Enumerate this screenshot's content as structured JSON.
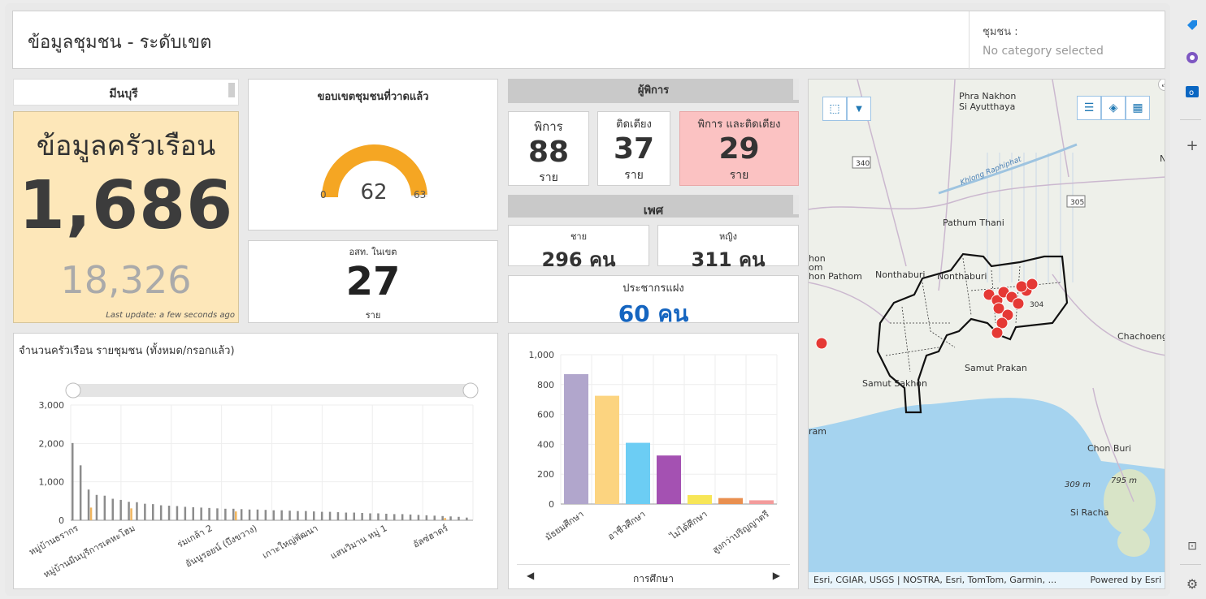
{
  "header": {
    "title": "ข้อมูลชุมชน - ระดับเขต",
    "selector_label": "ชุมชน :",
    "selector_value": "No category selected"
  },
  "district": {
    "name": "มีนบุรี"
  },
  "household": {
    "title": "ข้อมูลครัวเรือน",
    "count": "1,686",
    "total": "18,326",
    "last_update": "Last update: a few seconds ago"
  },
  "gauge": {
    "title": "ขอบเขตชุมชนที่วาดแล้ว",
    "value": "62",
    "min": "0",
    "max": "63",
    "value_num": 62,
    "max_num": 63,
    "color": "#f5a623"
  },
  "osm": {
    "title": "อสท. ในเขต",
    "value": "27",
    "unit": "ราย"
  },
  "disabled": {
    "header": "ผู้พิการ",
    "cards": [
      {
        "label": "พิการ",
        "value": "88",
        "unit": "ราย"
      },
      {
        "label": "ติดเตียง",
        "value": "37",
        "unit": "ราย"
      },
      {
        "label": "พิการ และติดเตียง",
        "value": "29",
        "unit": "ราย"
      }
    ]
  },
  "gender": {
    "header": "เพศ",
    "male_label": "ชาย",
    "male_value": "296 คน",
    "female_label": "หญิง",
    "female_value": "311 คน"
  },
  "hidden_pop": {
    "label": "ประชากรแฝง",
    "value": "60 คน"
  },
  "chart_data": [
    {
      "type": "bar",
      "title": "จำนวนครัวเรือน รายชุมชน (ทั้งหมด/กรอกแล้ว)",
      "ylim": [
        0,
        3000
      ],
      "yticks": [
        "0",
        "1,000",
        "2,000",
        "3,000"
      ],
      "x_labels_shown": [
        "หมู่บ้านธรากร",
        "หมู่บ้านมีนบุรีการเคหะโฮม",
        "ร่มเกล้า 2",
        "อันนูรอยน์ (บึงขวาง)",
        "เกาะใหญ่พัฒนา",
        "แสนวิมาน หมู่ 1",
        "อัลซ่ฮาดร์"
      ],
      "series": [
        {
          "color": "#8c8c8c",
          "values": [
            2010,
            1430,
            800,
            660,
            640,
            560,
            530,
            480,
            470,
            430,
            420,
            390,
            380,
            370,
            350,
            340,
            330,
            320,
            310,
            300,
            300,
            290,
            280,
            280,
            270,
            260,
            260,
            250,
            240,
            240,
            230,
            220,
            220,
            210,
            200,
            200,
            190,
            180,
            180,
            170,
            160,
            160,
            150,
            140,
            130,
            120,
            110,
            100,
            90,
            70
          ]
        },
        {
          "color": "#f0b55e",
          "values": [
            0,
            0,
            330,
            0,
            0,
            0,
            0,
            310,
            0,
            0,
            0,
            0,
            0,
            0,
            0,
            0,
            0,
            0,
            0,
            0,
            230,
            0,
            0,
            0,
            0,
            0,
            0,
            0,
            0,
            0,
            0,
            0,
            0,
            0,
            0,
            0,
            0,
            0,
            0,
            0,
            0,
            0,
            0,
            0,
            0,
            0,
            60,
            0,
            0,
            0
          ]
        }
      ]
    },
    {
      "type": "bar",
      "xlabel": "การศึกษา",
      "ylim": [
        0,
        1000
      ],
      "yticks": [
        "0",
        "200",
        "400",
        "600",
        "800",
        "1,000"
      ],
      "categories": [
        "มัธยมศึกษา",
        "อาชีวศึกษา",
        "ไม่ได้ศึกษา",
        "สูงกว่าปริญญาตรี"
      ],
      "bar_values": [
        870,
        725,
        410,
        325,
        60,
        40,
        25
      ],
      "bar_colors": [
        "#b1a6cc",
        "#fcd480",
        "#6ccdf4",
        "#a451b2",
        "#f7e657",
        "#e98f4f",
        "#f39b9b"
      ]
    }
  ],
  "map": {
    "attribution": "Esri, CGIAR, USGS | NOSTRA, Esri, TomTom, Garmin, ...",
    "powered": "Powered by Esri",
    "places": [
      "Phra Nakhon",
      "Si Ayutthaya",
      "Pathum Thani",
      "Nonthaburi",
      "Nonthaburi",
      "Samut Prakan",
      "Samut Sakhon",
      "Chachoengs",
      "Chon Buri",
      "Si Racha",
      "hon Pathom",
      "hon",
      "om",
      "ram",
      "N"
    ],
    "roads": [
      "340",
      "305",
      "304"
    ],
    "canal": "Khlong Raphiphat",
    "peaks": [
      "309 m",
      "795 m"
    ]
  }
}
